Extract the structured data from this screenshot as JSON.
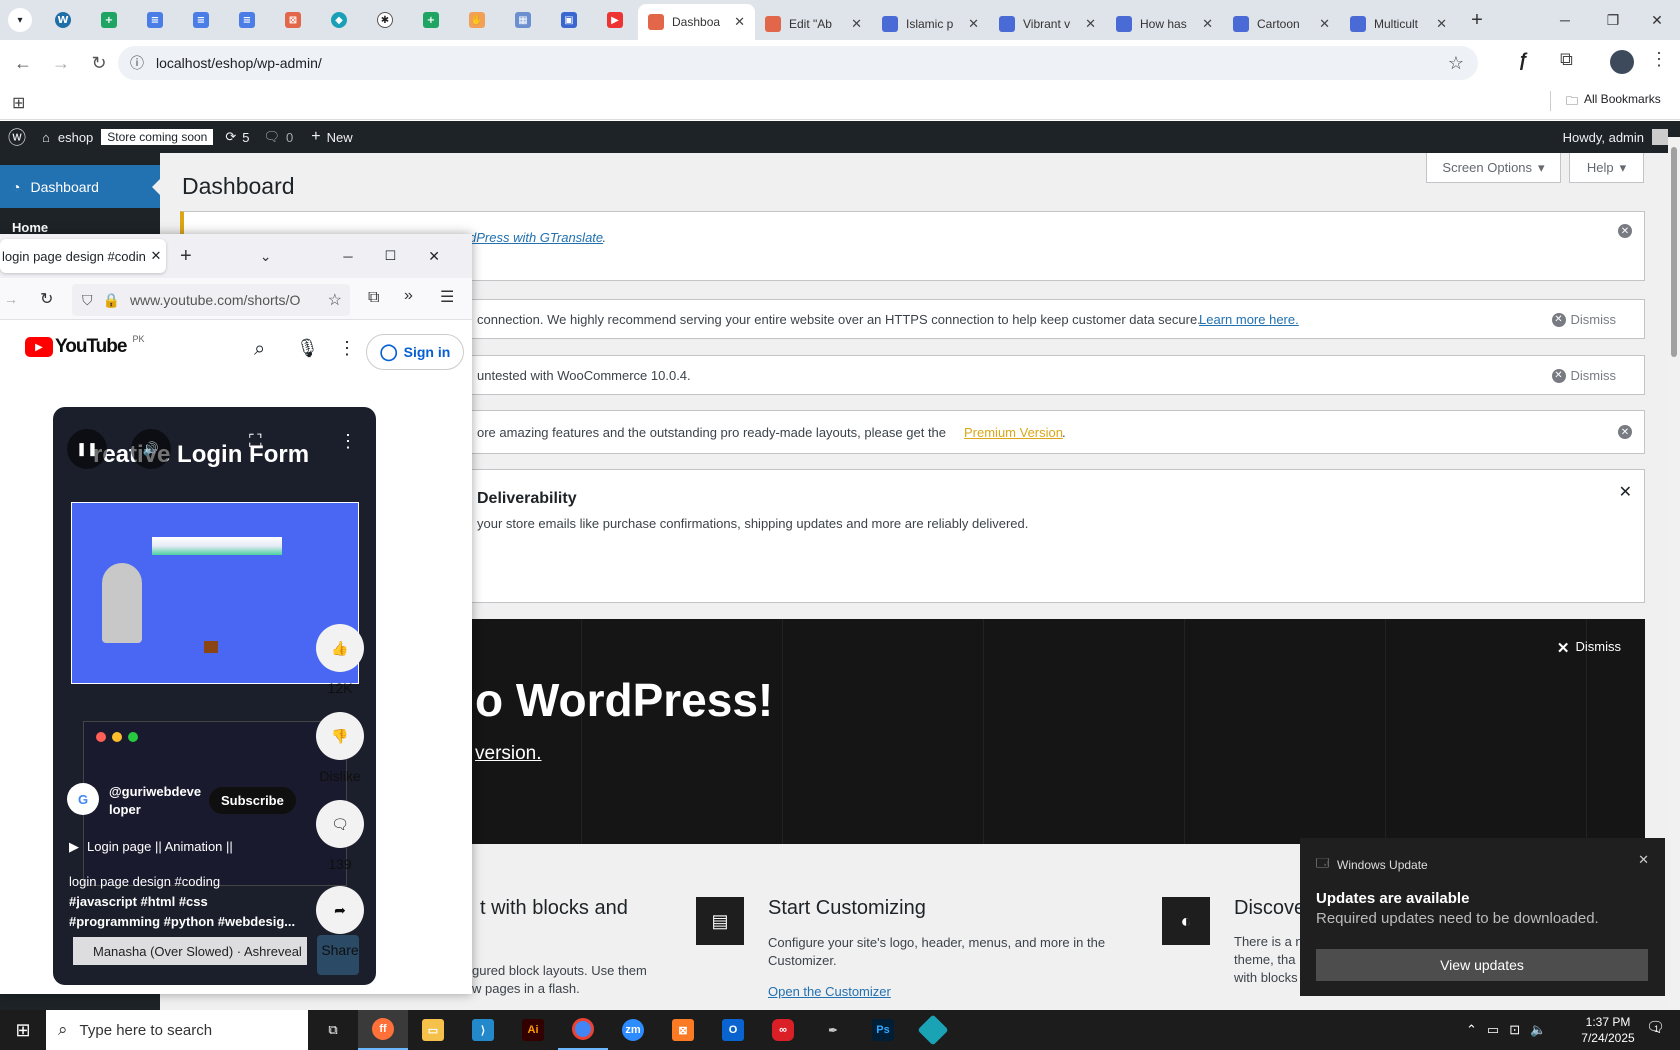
{
  "chrome": {
    "tabs": [
      {
        "title": "Dashboa",
        "color": "#e2674a",
        "active": true
      },
      {
        "title": "Edit \"Ab",
        "color": "#e2674a"
      },
      {
        "title": "Islamic p",
        "color": "#4a6bd6"
      },
      {
        "title": "Vibrant v",
        "color": "#4a6bd6"
      },
      {
        "title": "How has",
        "color": "#4a6bd6"
      },
      {
        "title": "Cartoon",
        "color": "#4a6bd6"
      },
      {
        "title": "Multicult",
        "color": "#4a6bd6"
      }
    ],
    "url": "localhost/eshop/wp-admin/",
    "all_bookmarks": "All Bookmarks"
  },
  "adminbar": {
    "site_name": "eshop",
    "store_badge": "Store coming soon",
    "updates_count": "5",
    "comments_count": "0",
    "new_label": "New",
    "howdy": "Howdy, admin"
  },
  "sidebar": {
    "dashboard_label": "Dashboard",
    "home_label": "Home"
  },
  "main": {
    "page_title": "Dashboard",
    "screen_options": "Screen Options",
    "help": "Help",
    "notice1_link": "dPress with GTranslate",
    "notice2_text": "connection. We highly recommend serving your entire website over an HTTPS connection to help keep customer data secure.",
    "notice2_link": "Learn more here.",
    "dismiss": "Dismiss",
    "notice3_text": "untested with WooCommerce 10.0.4.",
    "notice4_text": "ore amazing features and the outstanding pro ready-made layouts, please get the",
    "notice4_link": "Premium Version",
    "deliver_title": "Deliverability",
    "deliver_text": "your store emails like purchase confirmations, shipping updates and more are reliably delivered.",
    "welcome_dismiss": "Dismiss",
    "welcome_title": "o WordPress!",
    "welcome_link": "version.",
    "col1_title": "t with blocks and",
    "col1_text1": "gured block layouts. Use them",
    "col1_text2": "w pages in a flash.",
    "col2_title": "Start Customizing",
    "col2_text": "Configure your site's logo, header, menus, and more in the Customizer.",
    "col2_link": "Open the Customizer",
    "col3_title": "Discove",
    "col3_text1": "There is a n",
    "col3_text2": "theme, tha",
    "col3_text3": "with blocks"
  },
  "firefox": {
    "tab_title": "login page design #coding",
    "url": "www.youtube.com/shorts/Ovjk",
    "yt_brand": "YouTube",
    "yt_region": "PK",
    "sign_in": "Sign in",
    "video_title_overlay": "reative Login Form",
    "likes": "12K",
    "dislike": "Dislike",
    "comments": "139",
    "share": "Share",
    "channel": "@guriwebdeve\nloper",
    "subscribe": "Subscribe",
    "playlist": "Login page || Animation ||",
    "caption1": "login page design #coding",
    "caption2": "#javascript #html #css",
    "caption3": "#programming #python #webdesig...",
    "music": "Manasha (Over Slowed) · Ashreveal"
  },
  "toast": {
    "app": "Windows Update",
    "title": "Updates are available",
    "body": "Required updates need to be downloaded.",
    "button": "View updates"
  },
  "taskbar": {
    "search_placeholder": "Type here to search",
    "time": "1:37 PM",
    "date": "7/24/2025",
    "notif_count": "1"
  }
}
